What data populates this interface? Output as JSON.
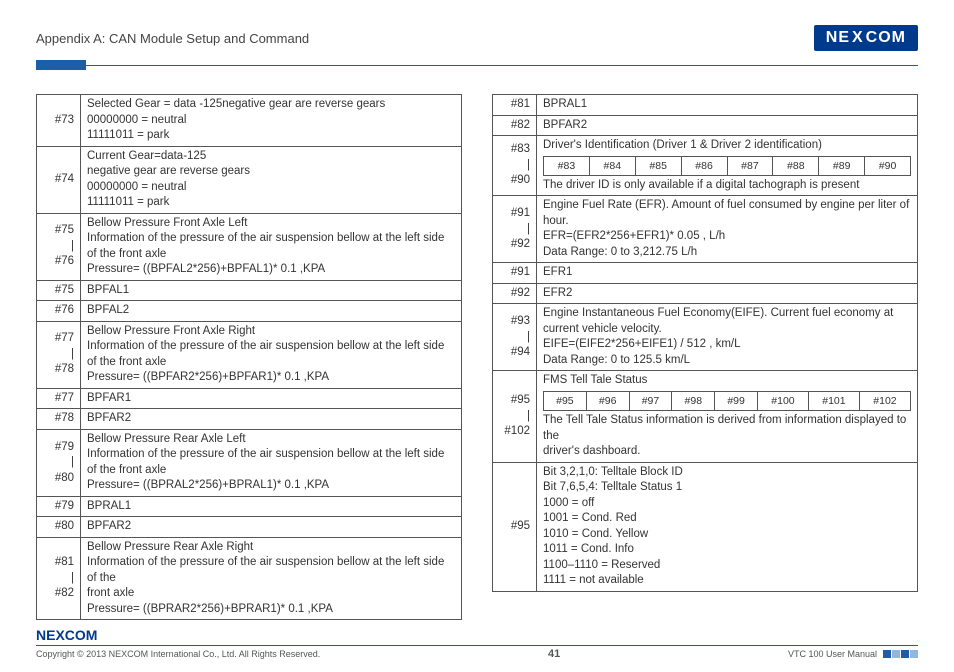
{
  "header": {
    "title": "Appendix A: CAN Module Setup and Command",
    "logo_text": "NEXCOM"
  },
  "left_table": [
    {
      "idx": "#73",
      "desc": "Selected Gear = data -125negative gear are reverse gears\n00000000 = neutral\n11111011 = park"
    },
    {
      "idx": "#74",
      "desc": "Current Gear=data-125\nnegative gear are reverse gears\n00000000 = neutral\n11111011 = park"
    },
    {
      "idx": "#75\n|\n#76",
      "desc": "Bellow Pressure Front Axle Left\nInformation of the pressure of the air suspension bellow at the left side of the front axle\nPressure= ((BPFAL2*256)+BPFAL1)* 0.1 ,KPA"
    },
    {
      "idx": "#75",
      "desc": "BPFAL1"
    },
    {
      "idx": "#76",
      "desc": "BPFAL2"
    },
    {
      "idx": "#77\n|\n#78",
      "desc": "Bellow Pressure Front Axle Right\nInformation of the pressure of the air suspension bellow at the left side of the front axle\nPressure= ((BPFAR2*256)+BPFAR1)* 0.1 ,KPA"
    },
    {
      "idx": "#77",
      "desc": "BPFAR1"
    },
    {
      "idx": "#78",
      "desc": "BPFAR2"
    },
    {
      "idx": "#79\n|\n#80",
      "desc": "Bellow Pressure Rear Axle Left\nInformation of the pressure of the air suspension bellow at the left side of the front axle\nPressure= ((BPRAL2*256)+BPRAL1)* 0.1 ,KPA"
    },
    {
      "idx": "#79",
      "desc": "BPRAL1"
    },
    {
      "idx": "#80",
      "desc": "BPFAR2"
    },
    {
      "idx": "#81\n|\n#82",
      "desc": "Bellow Pressure Rear Axle Right\nInformation of the pressure of the air suspension bellow at the left side of the\nfront axle\nPressure= ((BPRAR2*256)+BPRAR1)* 0.1 ,KPA"
    }
  ],
  "right_table": {
    "rows_top": [
      {
        "idx": "#81",
        "desc": "BPRAL1"
      },
      {
        "idx": "#82",
        "desc": "BPFAR2"
      }
    ],
    "row_driver_id": {
      "idx": "#83\n|\n#90",
      "title": "Driver's Identification (Driver 1 & Driver 2 identification)",
      "sub": [
        "#83",
        "#84",
        "#85",
        "#86",
        "#87",
        "#88",
        "#89",
        "#90"
      ],
      "note": "The driver ID is only available if a digital tachograph is present"
    },
    "row_efr": {
      "idx": "#91\n|\n#92",
      "desc": "Engine Fuel Rate (EFR). Amount of fuel consumed by engine per liter of hour.\nEFR=(EFR2*256+EFR1)* 0.05 , L/h\nData Range: 0 to 3,212.75 L/h"
    },
    "rows_mid": [
      {
        "idx": "#91",
        "desc": "EFR1"
      },
      {
        "idx": "#92",
        "desc": "EFR2"
      }
    ],
    "row_eife": {
      "idx": "#93\n|\n#94",
      "desc": "Engine Instantaneous Fuel Economy(EIFE). Current fuel economy at current vehicle velocity.\nEIFE=(EIFE2*256+EIFE1) / 512 , km/L\nData Range: 0 to 125.5 km/L"
    },
    "row_fms": {
      "idx": "#95\n|\n#102",
      "title": "FMS Tell Tale Status",
      "sub": [
        "#95",
        "#96",
        "#97",
        "#98",
        "#99",
        "#100",
        "#101",
        "#102"
      ],
      "note": "The Tell Tale Status information is derived from information displayed to the\ndriver's dashboard."
    },
    "row_95": {
      "idx": "#95",
      "desc": "Bit 3,2,1,0: Telltale Block ID\nBit 7,6,5,4: Telltale Status 1\n1000 = off\n1001 = Cond. Red\n1010 = Cond. Yellow\n1011 = Cond. Info\n1100–1110 = Reserved\n1111 = not available"
    }
  },
  "footer": {
    "copyright": "Copyright © 2013 NEXCOM International Co., Ltd. All Rights Reserved.",
    "page": "41",
    "manual": "VTC 100 User Manual"
  }
}
